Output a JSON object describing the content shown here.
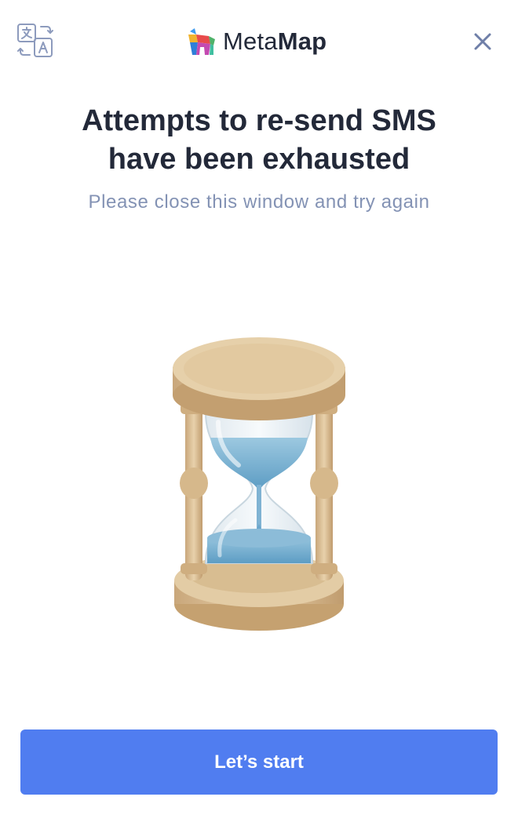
{
  "header": {
    "brand_light": "Meta",
    "brand_bold": "Map",
    "language_icon": "translate-icon",
    "close_icon": "close-icon"
  },
  "main": {
    "title_line1": "Attempts to re-send SMS",
    "title_line2": "have been exhausted",
    "subtitle": "Please close this window and try again",
    "illustration": "hourglass-icon"
  },
  "footer": {
    "start_label": "Let’s start"
  },
  "colors": {
    "accent": "#507df0",
    "title": "#232939",
    "subtitle": "#8392b4",
    "icon": "#6f7fa8"
  }
}
